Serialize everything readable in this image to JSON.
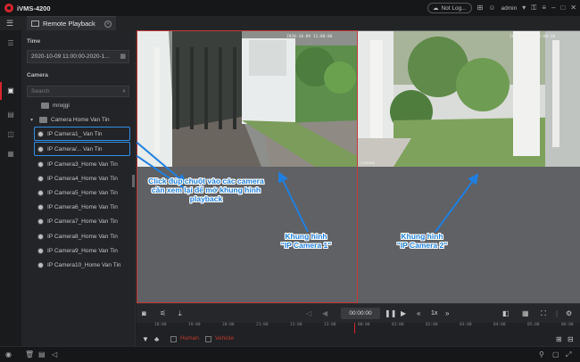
{
  "app": {
    "title": "iVMS-4200"
  },
  "titlebar": {
    "cloud_status": "Not Log...",
    "user": "admin"
  },
  "tab": {
    "label": "Remote Playback"
  },
  "left_panel": {
    "time_title": "Time",
    "time_range": "2020-10-09 11:00:00-2020-1...",
    "camera_title": "Camera",
    "search_placeholder": "Search",
    "tree": [
      {
        "type": "folder",
        "label": "mnxjgi"
      },
      {
        "type": "group",
        "label": "Camera Home Van Tin"
      },
      {
        "type": "camera",
        "label": "IP Camera1_ Van Tin"
      },
      {
        "type": "camera",
        "label": "IP Camera/... Van Tin"
      },
      {
        "type": "camera",
        "label": "IP Camera3_Home Van Tin"
      },
      {
        "type": "camera",
        "label": "IP Camera4_Home Van Tin"
      },
      {
        "type": "camera",
        "label": "IP Camera5_Home Van Tin"
      },
      {
        "type": "camera",
        "label": "IP Camera6_Home Van Tin"
      },
      {
        "type": "camera",
        "label": "IP Camera7_Home Van Tin"
      },
      {
        "type": "camera",
        "label": "IP Camera8_Home Van Tin"
      },
      {
        "type": "camera",
        "label": "IP Camera9_Home Van Tin"
      },
      {
        "type": "camera",
        "label": "IP Camera10_Home Van Tin"
      }
    ]
  },
  "playback": {
    "cam1_timestamp": "2020-10-09 11:00:06",
    "cam2_timestamp": "2020-10-09 11:00:06",
    "cam2_name": "Camera",
    "time_display": "00:00:00",
    "speed": "1x"
  },
  "annotations": {
    "instruction": "Click đúp chuột vào các camera cần xem lại để mở khung hình playback",
    "frame1_line1": "Khung hình",
    "frame1_line2": "\"IP Camera 1\"",
    "frame2_line1": "Khung hình",
    "frame2_line2": "\"IP Camera 2\"",
    "color": "#1f7fe0"
  },
  "timeline": {
    "ticks": [
      "18:00",
      "19:00",
      "20:00",
      "21:00",
      "22:00",
      "23:00",
      "00:00",
      "01:00",
      "02:00",
      "03:00",
      "04:00",
      "05:00",
      "06:00"
    ]
  },
  "filters": {
    "human": "Human",
    "vehicle": "Vehicle"
  },
  "colors": {
    "accent": "#d6262b",
    "highlight": "#2f8fe8"
  }
}
